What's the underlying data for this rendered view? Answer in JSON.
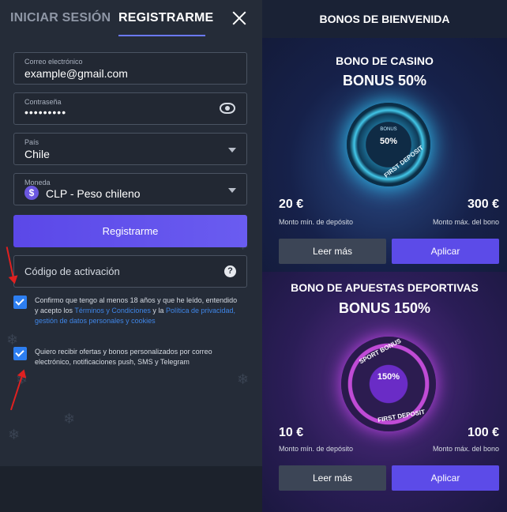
{
  "tabs": {
    "login": "INICIAR SESIÓN",
    "register": "REGISTRARME"
  },
  "form": {
    "email_label": "Correo electrónico",
    "email_value": "example@gmail.com",
    "password_label": "Contraseña",
    "password_value": "•••••••••",
    "country_label": "País",
    "country_value": "Chile",
    "currency_label": "Moneda",
    "currency_symbol": "$",
    "currency_value": "CLP - Peso chileno",
    "register_button": "Registrarme",
    "activation_placeholder": "Código de activación",
    "help_symbol": "?"
  },
  "consents": {
    "terms_prefix": "Confirmo que tengo al menos 18 años y que he leído, entendido y acepto los ",
    "terms_link": "Términos y Condiciones",
    "terms_middle": " y la ",
    "privacy_link": "Política de privacidad, gestión de datos personales y cookies",
    "marketing_text": "Quiero recibir ofertas y bonos personalizados por correo electrónico, notificaciones push, SMS y Telegram"
  },
  "bonuses": {
    "header": "BONOS DE BIENVENIDA",
    "casino": {
      "title": "BONO DE CASINO",
      "bonus": "BONUS 50%",
      "badge_small": "BONUS",
      "badge_pct": "50%",
      "badge_arc": "FIRST DEPOSIT",
      "min_amount": "20 €",
      "min_label": "Monto mín. de depósito",
      "max_amount": "300 €",
      "max_label": "Monto máx. del bono",
      "more_button": "Leer más",
      "apply_button": "Aplicar"
    },
    "sports": {
      "title": "BONO DE APUESTAS DEPORTIVAS",
      "bonus": "BONUS 150%",
      "badge_top": "SPORT BONUS",
      "badge_pct": "150%",
      "badge_arc": "FIRST DEPOSIT",
      "min_amount": "10 €",
      "min_label": "Monto mín. de depósito",
      "max_amount": "100 €",
      "max_label": "Monto máx. del bono",
      "more_button": "Leer más",
      "apply_button": "Aplicar"
    }
  },
  "colors": {
    "accent": "#5c4be8",
    "checkbox": "#2d7ef0",
    "link": "#3f86e8",
    "annotation_arrow": "#e02020"
  }
}
